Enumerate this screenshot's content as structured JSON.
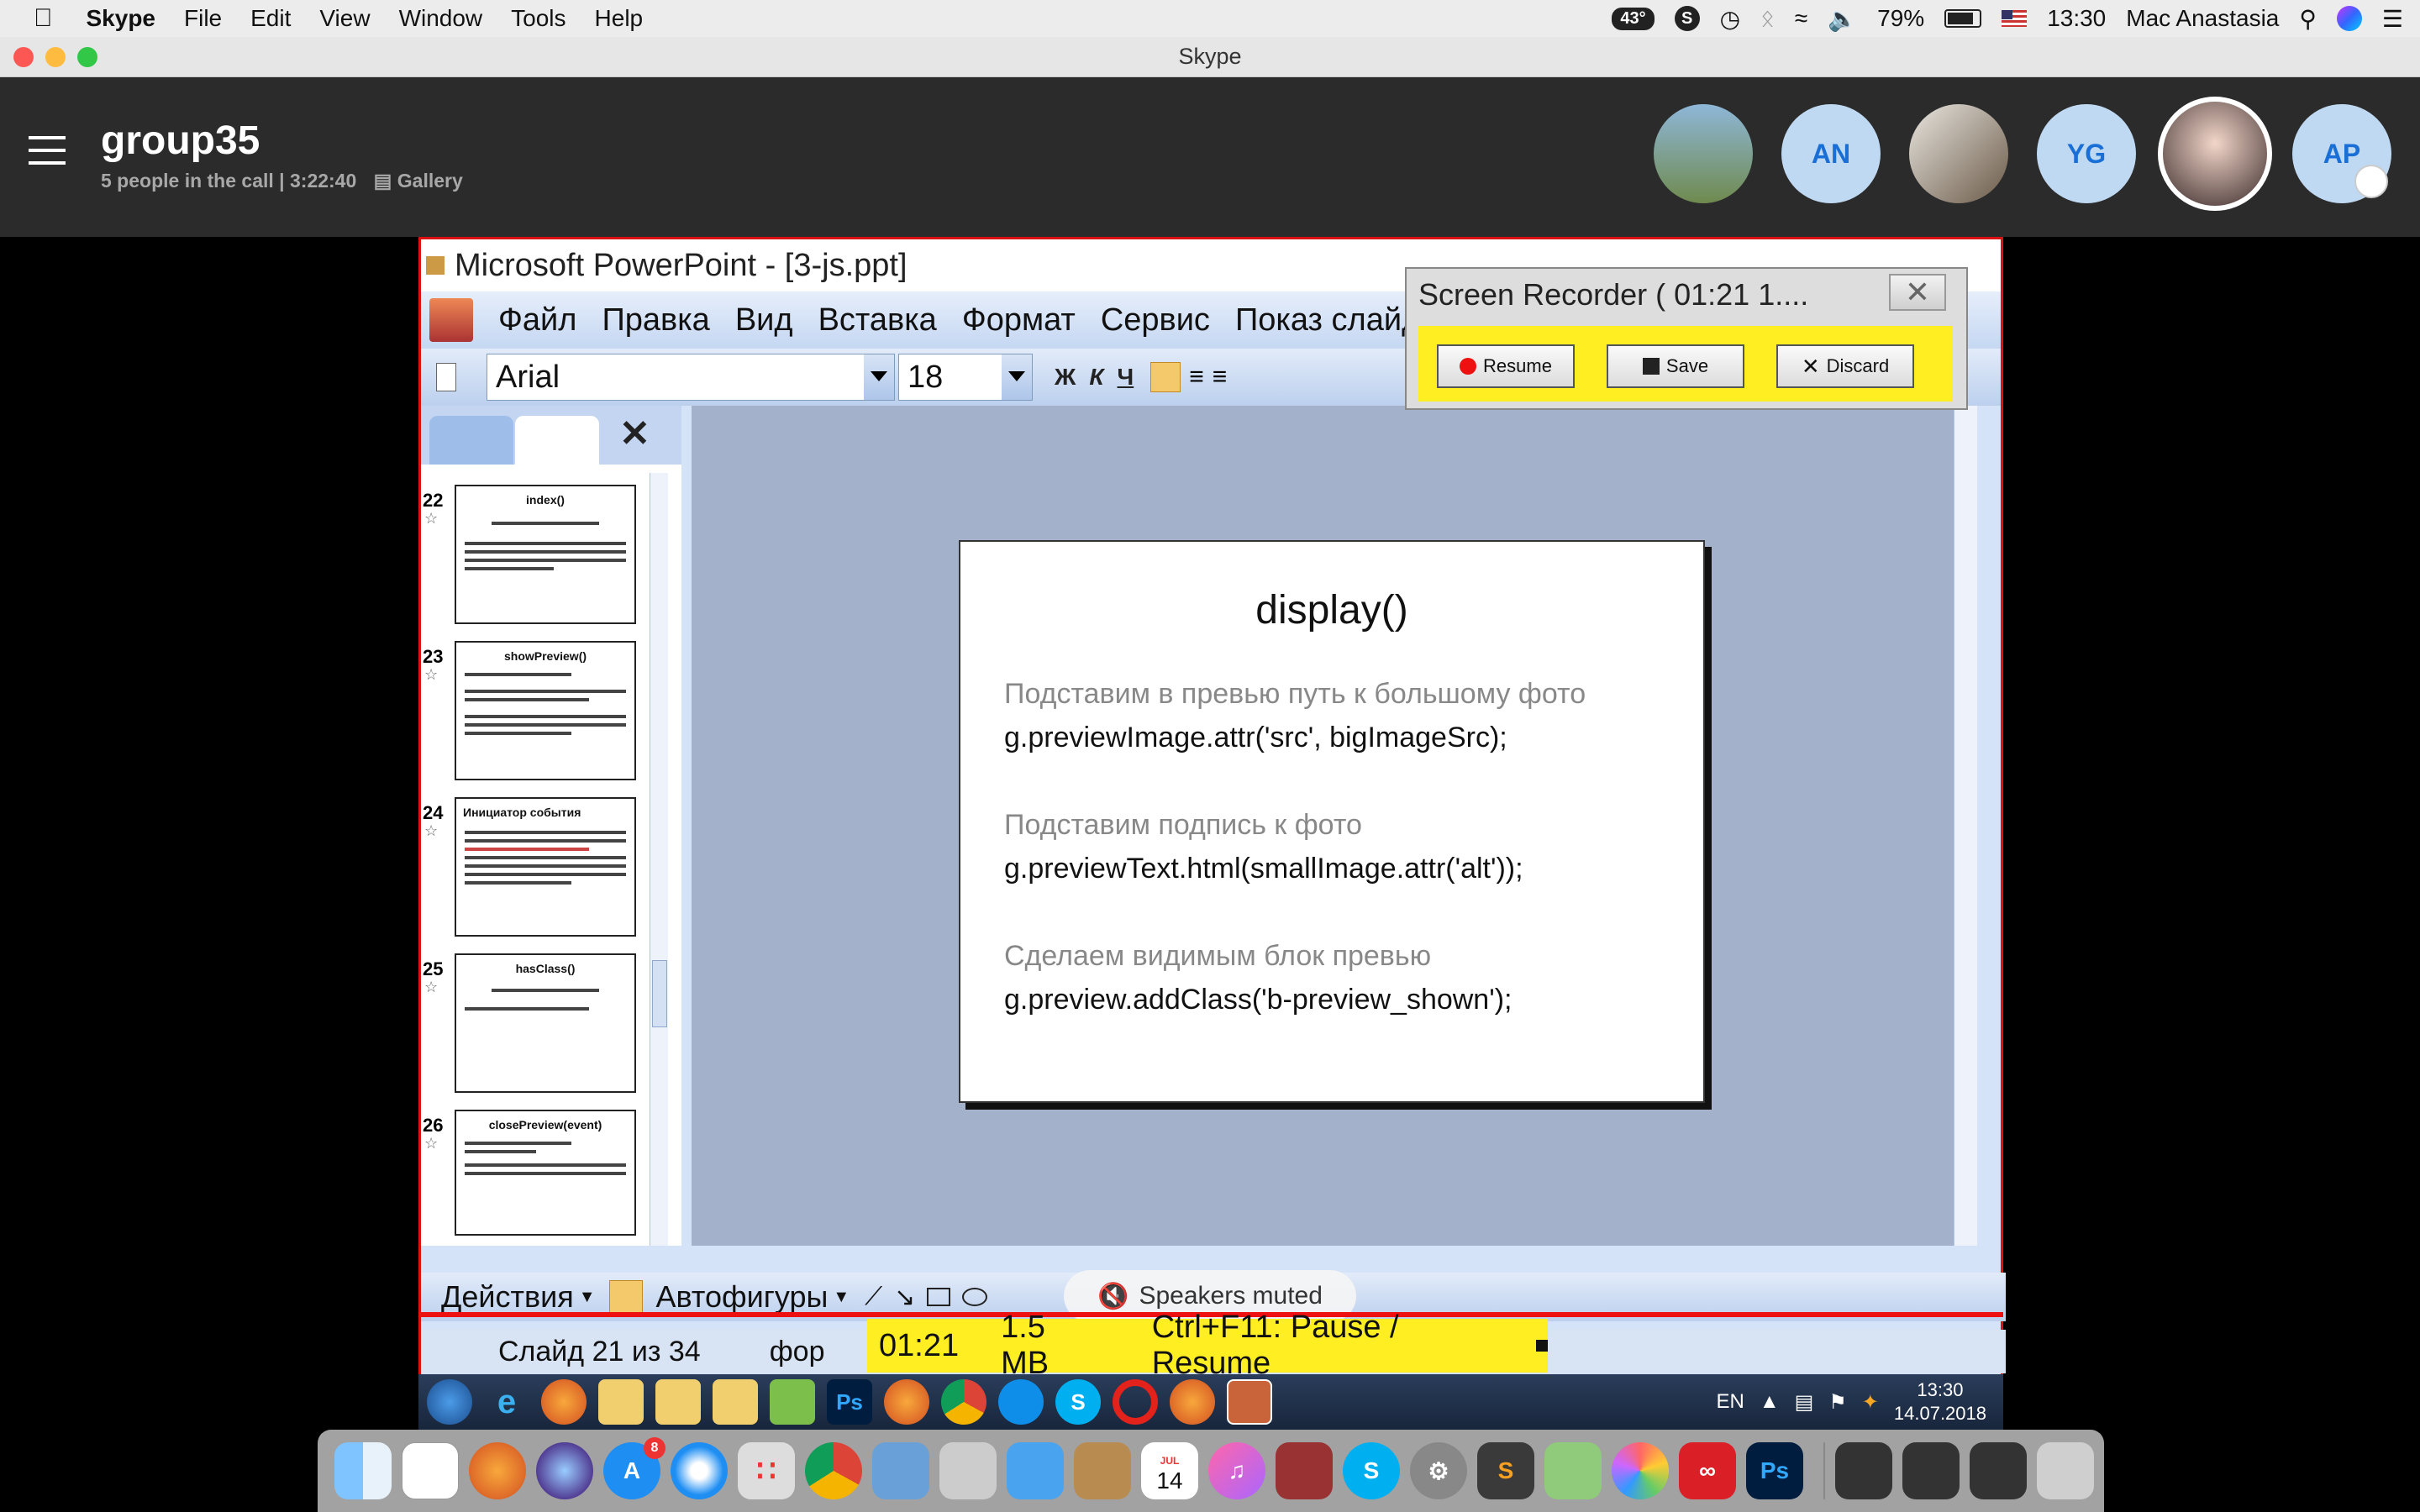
{
  "menubar": {
    "app_name": "Skype",
    "items": [
      "File",
      "Edit",
      "View",
      "Window",
      "Tools",
      "Help"
    ],
    "temperature": "43°",
    "battery": "79%",
    "time": "13:30",
    "user": "Mac Anastasia"
  },
  "window": {
    "title": "Skype"
  },
  "call": {
    "group_name": "group35",
    "info": "5 people in the call | 3:22:40",
    "separator": "|",
    "view_mode": "Gallery",
    "participants": [
      {
        "initials": ""
      },
      {
        "initials": "AN"
      },
      {
        "initials": ""
      },
      {
        "initials": "YG"
      },
      {
        "initials": ""
      },
      {
        "initials": "AP"
      }
    ]
  },
  "ppt": {
    "title": "Microsoft PowerPoint - [3-js.ppt]",
    "menu": [
      "Файл",
      "Правка",
      "Вид",
      "Вставка",
      "Формат",
      "Сервис",
      "Показ слайдов"
    ],
    "font_name": "Arial",
    "font_size": "18",
    "fmt_bold": "Ж",
    "fmt_italic": "К",
    "fmt_underline": "Ч",
    "thumbnails": [
      {
        "num": "22",
        "title": "index()"
      },
      {
        "num": "23",
        "title": "showPreview()"
      },
      {
        "num": "24",
        "title": "Инициатор события"
      },
      {
        "num": "25",
        "title": "hasClass()"
      },
      {
        "num": "26",
        "title": "closePreview(event)"
      }
    ],
    "slide": {
      "title": "display()",
      "lines": [
        {
          "comment": "Подставим в превью путь к большому фото",
          "code": "g.previewImage.attr('src', bigImageSrc);"
        },
        {
          "comment": "Подставим подпись к фото",
          "code": "g.previewText.html(smallImage.attr('alt'));"
        },
        {
          "comment": "Сделаем видимым блок превью",
          "code": "g.preview.addClass('b-preview_shown');"
        }
      ]
    },
    "draw_actions": "Действия",
    "autoshapes": "Автофигуры",
    "status_slide": "Слайд 21 из 34",
    "status_design": "фор"
  },
  "recorder": {
    "title": "Screen Recorder ( 01:21   1....",
    "resume": "Resume",
    "save": "Save",
    "discard": "Discard",
    "time": "01:21",
    "size": "1.5 MB",
    "hint": "Ctrl+F11: Pause / Resume"
  },
  "speakers": {
    "label": "Speakers muted"
  },
  "windows_tray": {
    "lang": "EN",
    "time": "13:30",
    "date": "14.07.2018"
  },
  "dock": {
    "appstore_badge": "8",
    "calendar_month": "JUL",
    "calendar_day": "14"
  }
}
